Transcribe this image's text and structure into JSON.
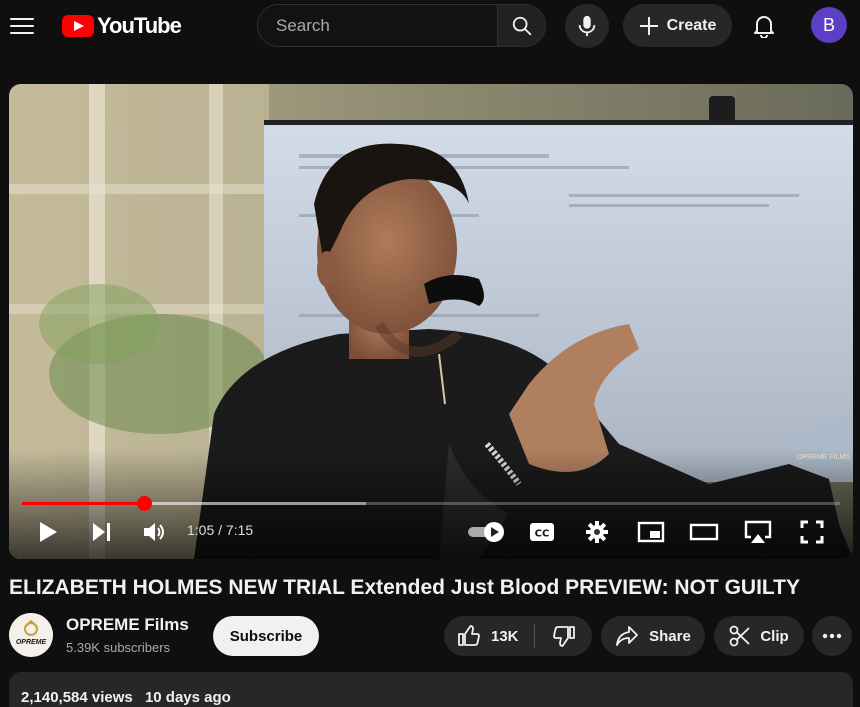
{
  "header": {
    "logo_text": "YouTube",
    "search_placeholder": "Search",
    "create_label": "Create",
    "avatar_initial": "B"
  },
  "player": {
    "current_time": "1:05",
    "duration": "7:15",
    "time_display": "1:05 / 7:15",
    "progress_fraction": 0.1494,
    "buffered_fraction": 0.42,
    "cc_label": "CC",
    "watermark_text": "OPREME FILMS"
  },
  "video": {
    "title": "ELIZABETH HOLMES NEW TRIAL Extended Just Blood PREVIEW: NOT GUILTY"
  },
  "channel": {
    "name": "OPREME Films",
    "subscribers": "5.39K subscribers",
    "avatar_text": "OPREME",
    "subscribe_label": "Subscribe"
  },
  "actions": {
    "like_count": "13K",
    "share_label": "Share",
    "clip_label": "Clip"
  },
  "description": {
    "views": "2,140,584 views",
    "age": "10 days ago"
  },
  "colors": {
    "background": "#0f0f0f",
    "accent_red": "#ff0000",
    "pill_bg": "#272727",
    "avatar_bg": "#5c3fc4"
  }
}
